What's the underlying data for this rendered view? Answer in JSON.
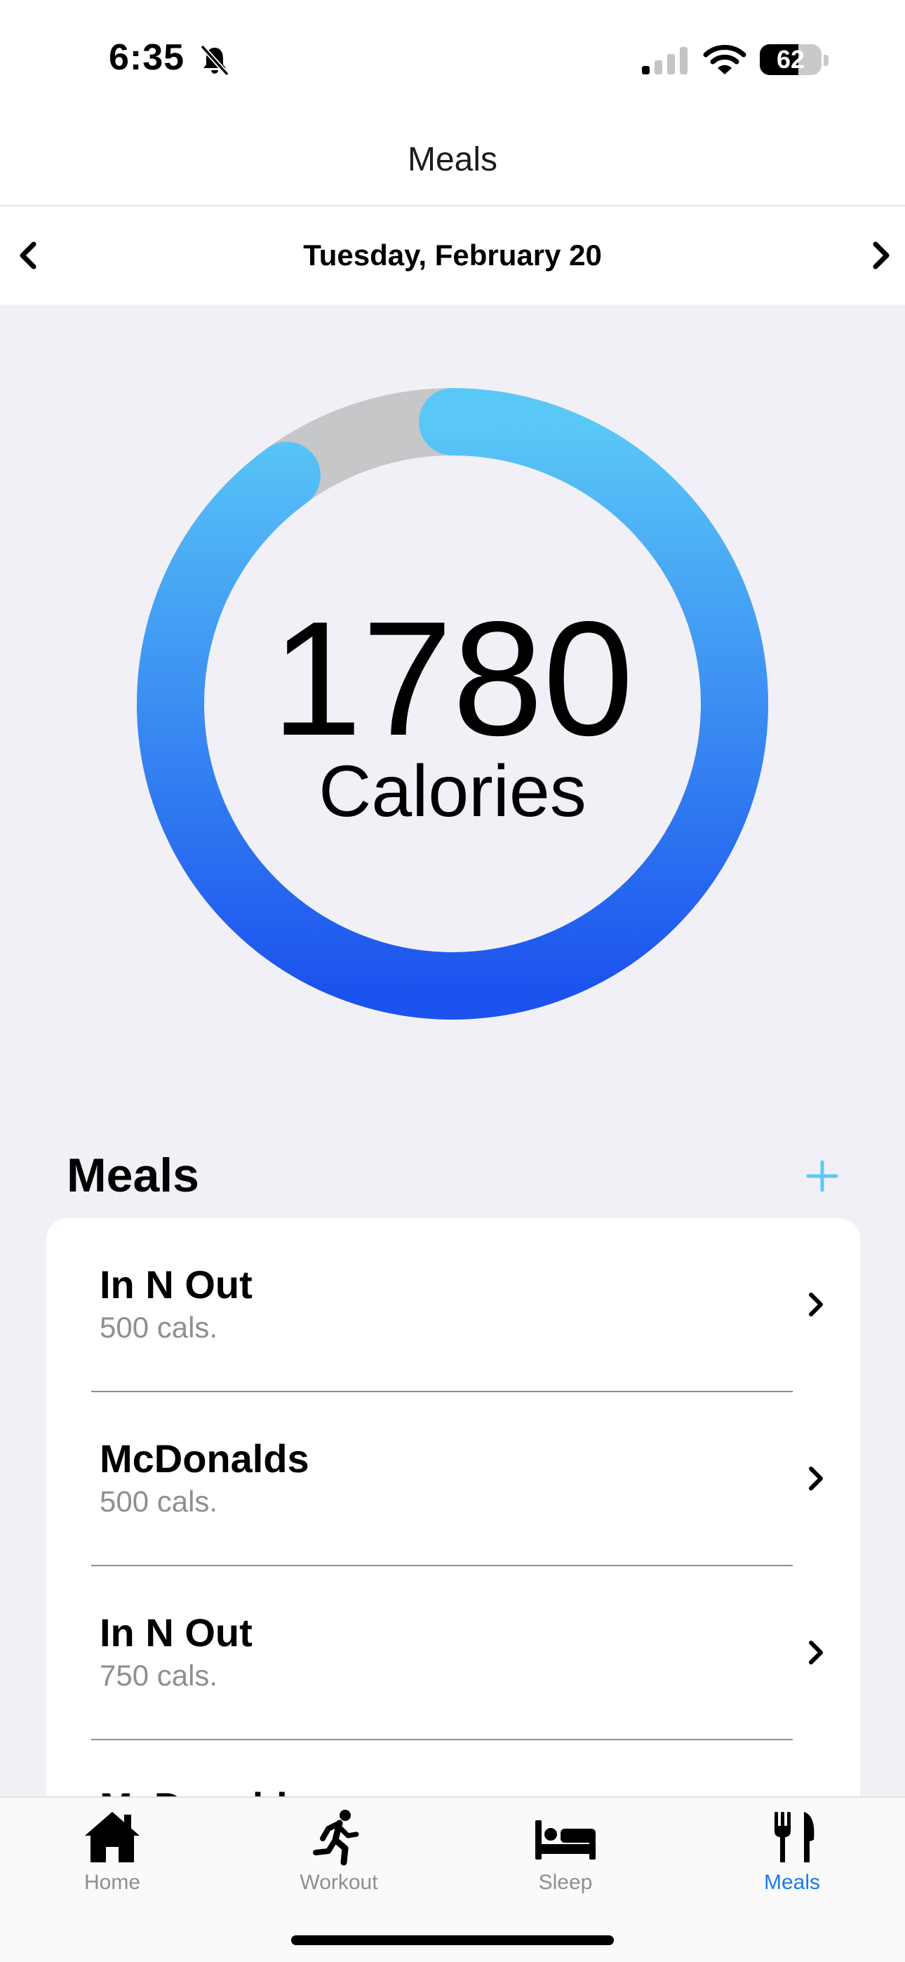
{
  "status_bar": {
    "time": "6:35",
    "battery": "62",
    "battery_level": 0.62
  },
  "nav": {
    "title": "Meals"
  },
  "date_bar": {
    "date": "Tuesday, February 20"
  },
  "calories": {
    "value": "1780",
    "label": "Calories",
    "progress": 0.9
  },
  "colors": {
    "accent": "#1b7bec",
    "ring_start": "#1c53ee",
    "ring_end": "#5ac8f7",
    "ring_track": "#c6c7c9"
  },
  "meals": {
    "title": "Meals",
    "items": [
      {
        "name": "In N Out",
        "calories": "500 cals."
      },
      {
        "name": "McDonalds",
        "calories": "500 cals."
      },
      {
        "name": "In N Out",
        "calories": "750 cals."
      },
      {
        "name": "McDonalds",
        "calories": ""
      }
    ]
  },
  "tabs": [
    {
      "label": "Home",
      "icon": "house-icon"
    },
    {
      "label": "Workout",
      "icon": "running-figure-icon"
    },
    {
      "label": "Sleep",
      "icon": "bed-icon"
    },
    {
      "label": "Meals",
      "icon": "fork-knife-icon"
    }
  ]
}
